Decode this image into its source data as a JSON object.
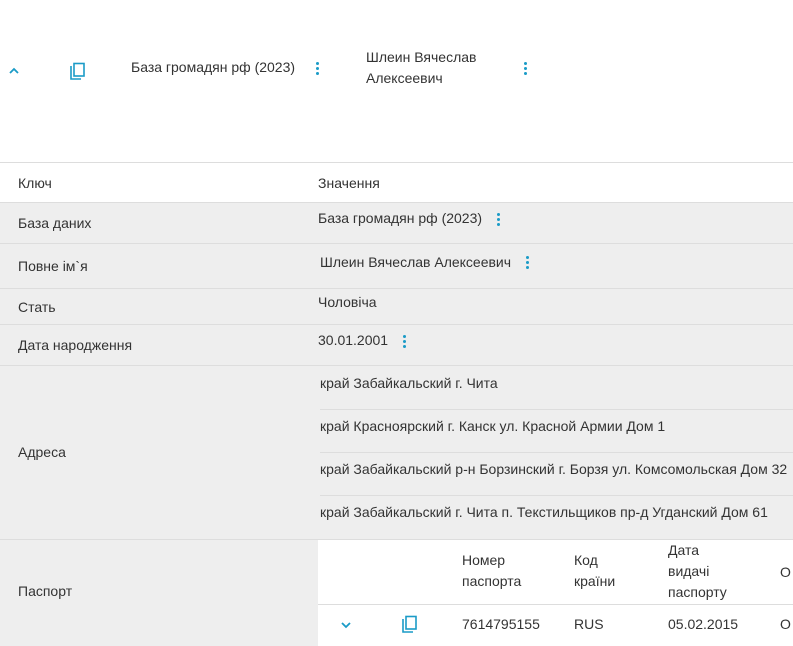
{
  "header": {
    "database": "База громадян рф (2023)",
    "name_line1": "Шлеин Вячеслав",
    "name_line2": "Алексеевич",
    "collapse_icon": "chevron-up-icon",
    "copy_icon": "copy-icon",
    "menu_icon": "kebab-menu-icon"
  },
  "table": {
    "col_key": "Ключ",
    "col_value": "Значення",
    "rows": {
      "database": {
        "key": "База даних",
        "value": "База громадян рф (2023)"
      },
      "fullname": {
        "key": "Повне ім`я",
        "value": "Шлеин Вячеслав Алексеевич"
      },
      "gender": {
        "key": "Стать",
        "value": "Чоловіча"
      },
      "birthdate": {
        "key": "Дата народження",
        "value": "30.01.2001"
      },
      "address": {
        "key": "Адреса",
        "values": [
          "край Забайкальский г. Чита",
          "край Красноярский г. Канск ул. Красной Армии Дом 1",
          "край Забайкальский р-н Борзинский г. Борзя ул. Комсомольская Дом 32",
          "край Забайкальский г. Чита п. Текстильщиков пр-д Угданский Дом 61"
        ]
      },
      "passport": {
        "key": "Паспорт",
        "headers": {
          "number_l1": "Номер",
          "number_l2": "паспорта",
          "country_l1": "Код",
          "country_l2": "країни",
          "date_l1": "Дата",
          "date_l2": "видачі",
          "date_l3": "паспорту",
          "issuer_partial": "О"
        },
        "row": {
          "number": "7614795155",
          "country": "RUS",
          "date": "05.02.2015",
          "issuer_partial": "О"
        }
      }
    }
  },
  "colors": {
    "accent": "#1a9bc7",
    "row_gray": "#eeeeee",
    "border": "#dddddd",
    "text": "#333333"
  }
}
